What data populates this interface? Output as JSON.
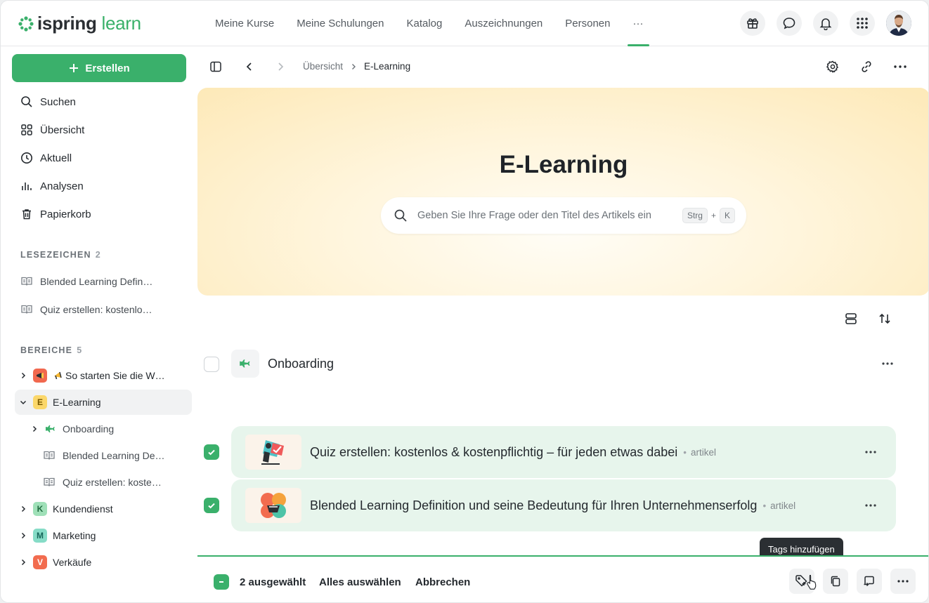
{
  "app": {
    "logo_main": "ispring",
    "logo_accent": "learn"
  },
  "nav": {
    "items": [
      "Meine Kurse",
      "Meine Schulungen",
      "Katalog",
      "Auszeichnungen",
      "Personen"
    ],
    "more": "···"
  },
  "sidebar": {
    "create_label": "Erstellen",
    "menu": [
      "Suchen",
      "Übersicht",
      "Aktuell",
      "Analysen",
      "Papierkorb"
    ],
    "bookmarks_title": "LESEZEICHEN",
    "bookmarks_count": "2",
    "bookmarks": [
      "Blended Learning Defin…",
      "Quiz erstellen: kostenlo…"
    ],
    "areas_title": "BEREICHE",
    "areas_count": "5",
    "tree": {
      "so_starten": {
        "badge": "",
        "label": "So starten Sie die W…"
      },
      "elearning": {
        "badge": "E",
        "label": "E-Learning"
      },
      "onboarding": {
        "label": "Onboarding"
      },
      "blended": {
        "label": "Blended Learning De…"
      },
      "quiz": {
        "label": "Quiz erstellen: koste…"
      },
      "kundendienst": {
        "badge": "K",
        "label": "Kundendienst"
      },
      "marketing": {
        "badge": "M",
        "label": "Marketing"
      },
      "verkaeufe": {
        "badge": "V",
        "label": "Verkäufe"
      }
    },
    "colors": {
      "accent": "#3ab06b",
      "badge_e": "#fbd76a",
      "badge_k": "#9fe0b8",
      "badge_m": "#86dcc7",
      "badge_v": "#f26c4f",
      "badge_s": "#f1684e"
    }
  },
  "breadcrumb": {
    "parent": "Übersicht",
    "current": "E-Learning"
  },
  "hero": {
    "title": "E-Learning",
    "search_placeholder": "Geben Sie Ihre Frage oder den Titel des Artikels ein",
    "kbd_ctrl": "Strg",
    "kbd_plus": "+",
    "kbd_key": "K"
  },
  "content": {
    "folder": {
      "title": "Onboarding"
    },
    "articles": [
      {
        "title": "Quiz erstellen: kostenlos & kostenpflichtig – für jeden etwas dabei",
        "type": "artikel"
      },
      {
        "title": "Blended Learning Definition und seine Bedeutung für Ihren Unternehmenserfolg",
        "type": "artikel"
      }
    ]
  },
  "selection": {
    "count_label": "2 ausgewählt",
    "select_all": "Alles auswählen",
    "cancel": "Abbrechen",
    "tooltip": "Tags hinzufügen"
  }
}
